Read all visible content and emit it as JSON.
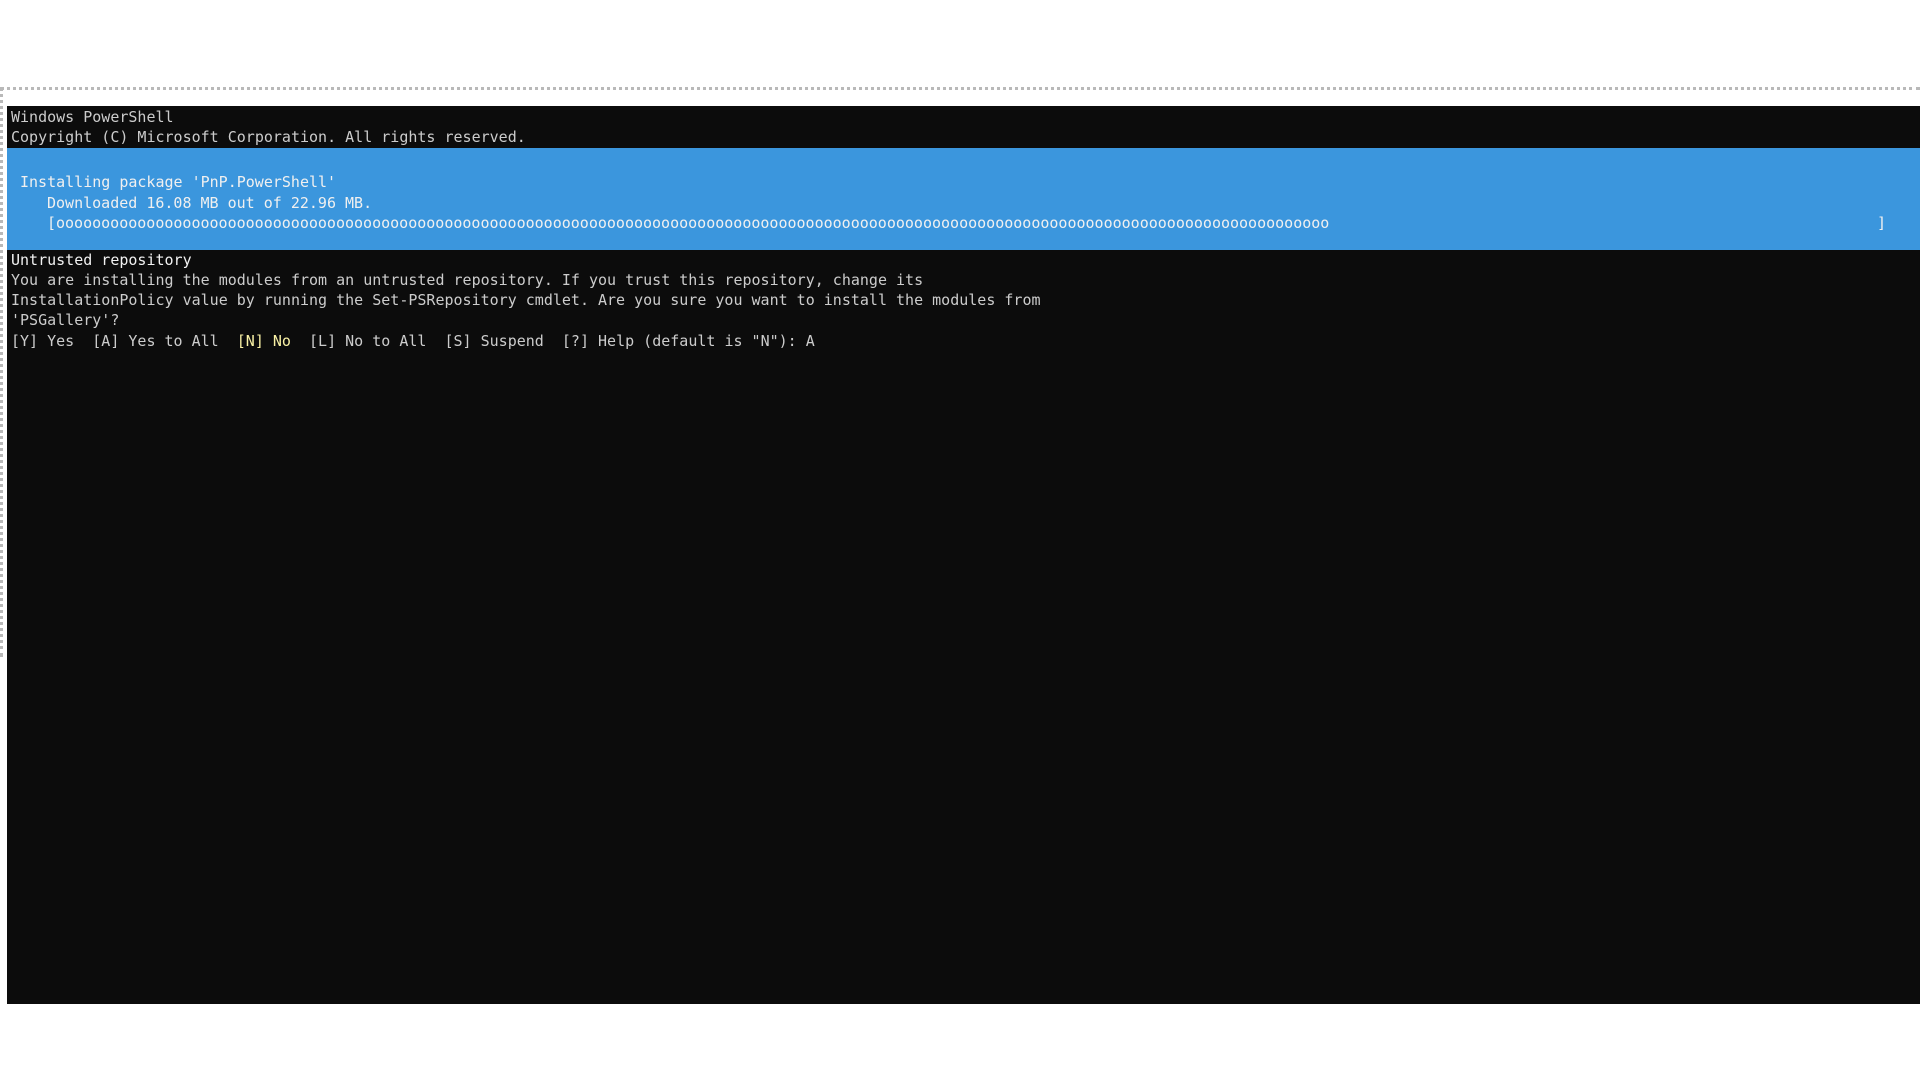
{
  "console": {
    "header": [
      "Windows PowerShell",
      "Copyright (C) Microsoft Corporation. All rights reserved."
    ],
    "progress": {
      "activity": "Installing package 'PnP.PowerShell'",
      "status": "Downloaded 16.08 MB out of 22.96 MB.",
      "bar_open": "[",
      "bar_fill_char": "o",
      "bar_close": "]",
      "fraction": 0.7
    },
    "prompt": {
      "caption": "Untrusted repository",
      "message": [
        "You are installing the modules from an untrusted repository. If you trust this repository, change its",
        "InstallationPolicy value by running the Set-PSRepository cmdlet. Are you sure you want to install the modules from",
        "'PSGallery'?"
      ],
      "choices": [
        {
          "label": "[Y] Yes",
          "default": false
        },
        {
          "label": "[A] Yes to All",
          "default": false
        },
        {
          "label": "[N] No",
          "default": true
        },
        {
          "label": "[L] No to All",
          "default": false
        },
        {
          "label": "[S] Suspend",
          "default": false
        }
      ],
      "help": "[?] Help (default is \"N\"): ",
      "input": "A"
    },
    "colors": {
      "background": "#0c0c0c",
      "foreground": "#cccccc",
      "progress_background": "#3b96dd",
      "default_choice": "#f9f1a5"
    }
  }
}
